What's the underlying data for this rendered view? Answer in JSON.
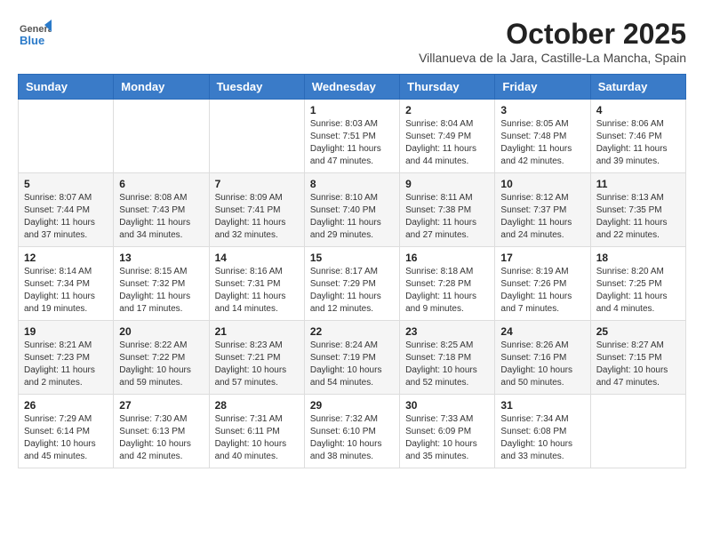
{
  "logo": {
    "general": "General",
    "blue": "Blue"
  },
  "title": "October 2025",
  "subtitle": "Villanueva de la Jara, Castille-La Mancha, Spain",
  "days_of_week": [
    "Sunday",
    "Monday",
    "Tuesday",
    "Wednesday",
    "Thursday",
    "Friday",
    "Saturday"
  ],
  "weeks": [
    [
      {
        "day": "",
        "info": ""
      },
      {
        "day": "",
        "info": ""
      },
      {
        "day": "",
        "info": ""
      },
      {
        "day": "1",
        "info": "Sunrise: 8:03 AM\nSunset: 7:51 PM\nDaylight: 11 hours and 47 minutes."
      },
      {
        "day": "2",
        "info": "Sunrise: 8:04 AM\nSunset: 7:49 PM\nDaylight: 11 hours and 44 minutes."
      },
      {
        "day": "3",
        "info": "Sunrise: 8:05 AM\nSunset: 7:48 PM\nDaylight: 11 hours and 42 minutes."
      },
      {
        "day": "4",
        "info": "Sunrise: 8:06 AM\nSunset: 7:46 PM\nDaylight: 11 hours and 39 minutes."
      }
    ],
    [
      {
        "day": "5",
        "info": "Sunrise: 8:07 AM\nSunset: 7:44 PM\nDaylight: 11 hours and 37 minutes."
      },
      {
        "day": "6",
        "info": "Sunrise: 8:08 AM\nSunset: 7:43 PM\nDaylight: 11 hours and 34 minutes."
      },
      {
        "day": "7",
        "info": "Sunrise: 8:09 AM\nSunset: 7:41 PM\nDaylight: 11 hours and 32 minutes."
      },
      {
        "day": "8",
        "info": "Sunrise: 8:10 AM\nSunset: 7:40 PM\nDaylight: 11 hours and 29 minutes."
      },
      {
        "day": "9",
        "info": "Sunrise: 8:11 AM\nSunset: 7:38 PM\nDaylight: 11 hours and 27 minutes."
      },
      {
        "day": "10",
        "info": "Sunrise: 8:12 AM\nSunset: 7:37 PM\nDaylight: 11 hours and 24 minutes."
      },
      {
        "day": "11",
        "info": "Sunrise: 8:13 AM\nSunset: 7:35 PM\nDaylight: 11 hours and 22 minutes."
      }
    ],
    [
      {
        "day": "12",
        "info": "Sunrise: 8:14 AM\nSunset: 7:34 PM\nDaylight: 11 hours and 19 minutes."
      },
      {
        "day": "13",
        "info": "Sunrise: 8:15 AM\nSunset: 7:32 PM\nDaylight: 11 hours and 17 minutes."
      },
      {
        "day": "14",
        "info": "Sunrise: 8:16 AM\nSunset: 7:31 PM\nDaylight: 11 hours and 14 minutes."
      },
      {
        "day": "15",
        "info": "Sunrise: 8:17 AM\nSunset: 7:29 PM\nDaylight: 11 hours and 12 minutes."
      },
      {
        "day": "16",
        "info": "Sunrise: 8:18 AM\nSunset: 7:28 PM\nDaylight: 11 hours and 9 minutes."
      },
      {
        "day": "17",
        "info": "Sunrise: 8:19 AM\nSunset: 7:26 PM\nDaylight: 11 hours and 7 minutes."
      },
      {
        "day": "18",
        "info": "Sunrise: 8:20 AM\nSunset: 7:25 PM\nDaylight: 11 hours and 4 minutes."
      }
    ],
    [
      {
        "day": "19",
        "info": "Sunrise: 8:21 AM\nSunset: 7:23 PM\nDaylight: 11 hours and 2 minutes."
      },
      {
        "day": "20",
        "info": "Sunrise: 8:22 AM\nSunset: 7:22 PM\nDaylight: 10 hours and 59 minutes."
      },
      {
        "day": "21",
        "info": "Sunrise: 8:23 AM\nSunset: 7:21 PM\nDaylight: 10 hours and 57 minutes."
      },
      {
        "day": "22",
        "info": "Sunrise: 8:24 AM\nSunset: 7:19 PM\nDaylight: 10 hours and 54 minutes."
      },
      {
        "day": "23",
        "info": "Sunrise: 8:25 AM\nSunset: 7:18 PM\nDaylight: 10 hours and 52 minutes."
      },
      {
        "day": "24",
        "info": "Sunrise: 8:26 AM\nSunset: 7:16 PM\nDaylight: 10 hours and 50 minutes."
      },
      {
        "day": "25",
        "info": "Sunrise: 8:27 AM\nSunset: 7:15 PM\nDaylight: 10 hours and 47 minutes."
      }
    ],
    [
      {
        "day": "26",
        "info": "Sunrise: 7:29 AM\nSunset: 6:14 PM\nDaylight: 10 hours and 45 minutes."
      },
      {
        "day": "27",
        "info": "Sunrise: 7:30 AM\nSunset: 6:13 PM\nDaylight: 10 hours and 42 minutes."
      },
      {
        "day": "28",
        "info": "Sunrise: 7:31 AM\nSunset: 6:11 PM\nDaylight: 10 hours and 40 minutes."
      },
      {
        "day": "29",
        "info": "Sunrise: 7:32 AM\nSunset: 6:10 PM\nDaylight: 10 hours and 38 minutes."
      },
      {
        "day": "30",
        "info": "Sunrise: 7:33 AM\nSunset: 6:09 PM\nDaylight: 10 hours and 35 minutes."
      },
      {
        "day": "31",
        "info": "Sunrise: 7:34 AM\nSunset: 6:08 PM\nDaylight: 10 hours and 33 minutes."
      },
      {
        "day": "",
        "info": ""
      }
    ]
  ]
}
